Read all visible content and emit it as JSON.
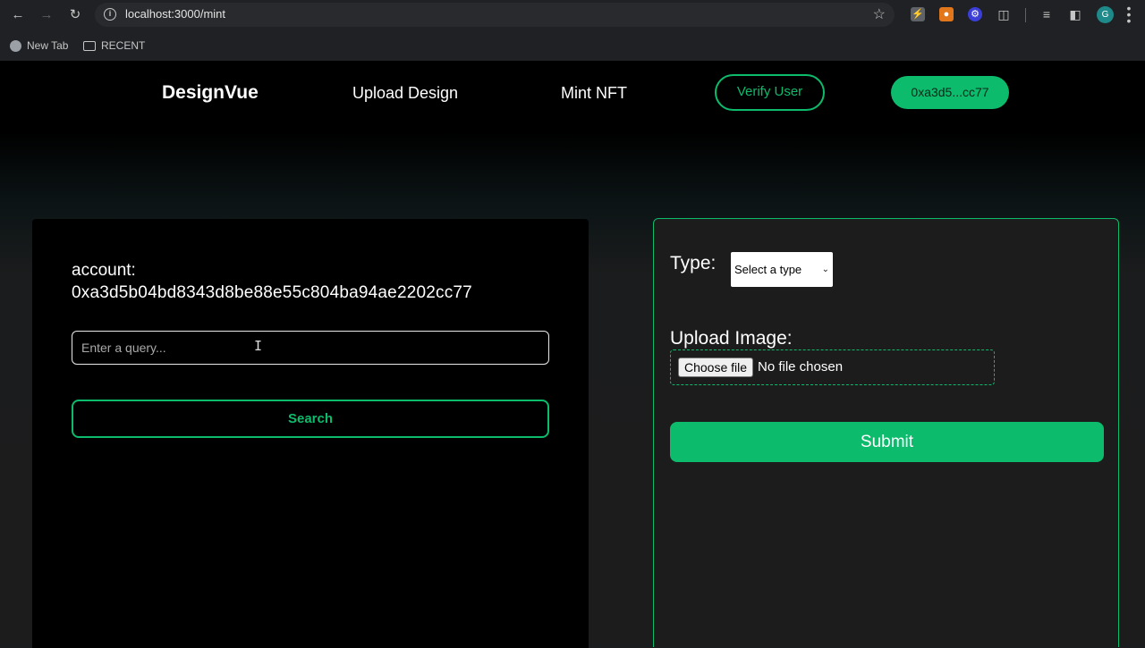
{
  "browser": {
    "url": "localhost:3000/mint",
    "bookmarks": [
      "New Tab",
      "RECENT"
    ],
    "profile_initial": "G"
  },
  "navbar": {
    "brand": "DesignVue",
    "links": [
      "Upload Design",
      "Mint NFT"
    ],
    "verify_label": "Verify User",
    "wallet_label": "0xa3d5...cc77"
  },
  "search_panel": {
    "account_label": "account:",
    "account_value": "0xa3d5b04bd8343d8be88e55c804ba94ae2202cc77",
    "query_placeholder": "Enter a query...",
    "search_label": "Search"
  },
  "mint_form": {
    "type_label": "Type:",
    "type_selected": "Select a type",
    "upload_label": "Upload Image:",
    "choose_file_label": "Choose file",
    "file_status": "No file chosen",
    "submit_label": "Submit"
  },
  "colors": {
    "accent": "#0cbb6b",
    "background": "#1c1c1d",
    "panel": "#000000"
  }
}
